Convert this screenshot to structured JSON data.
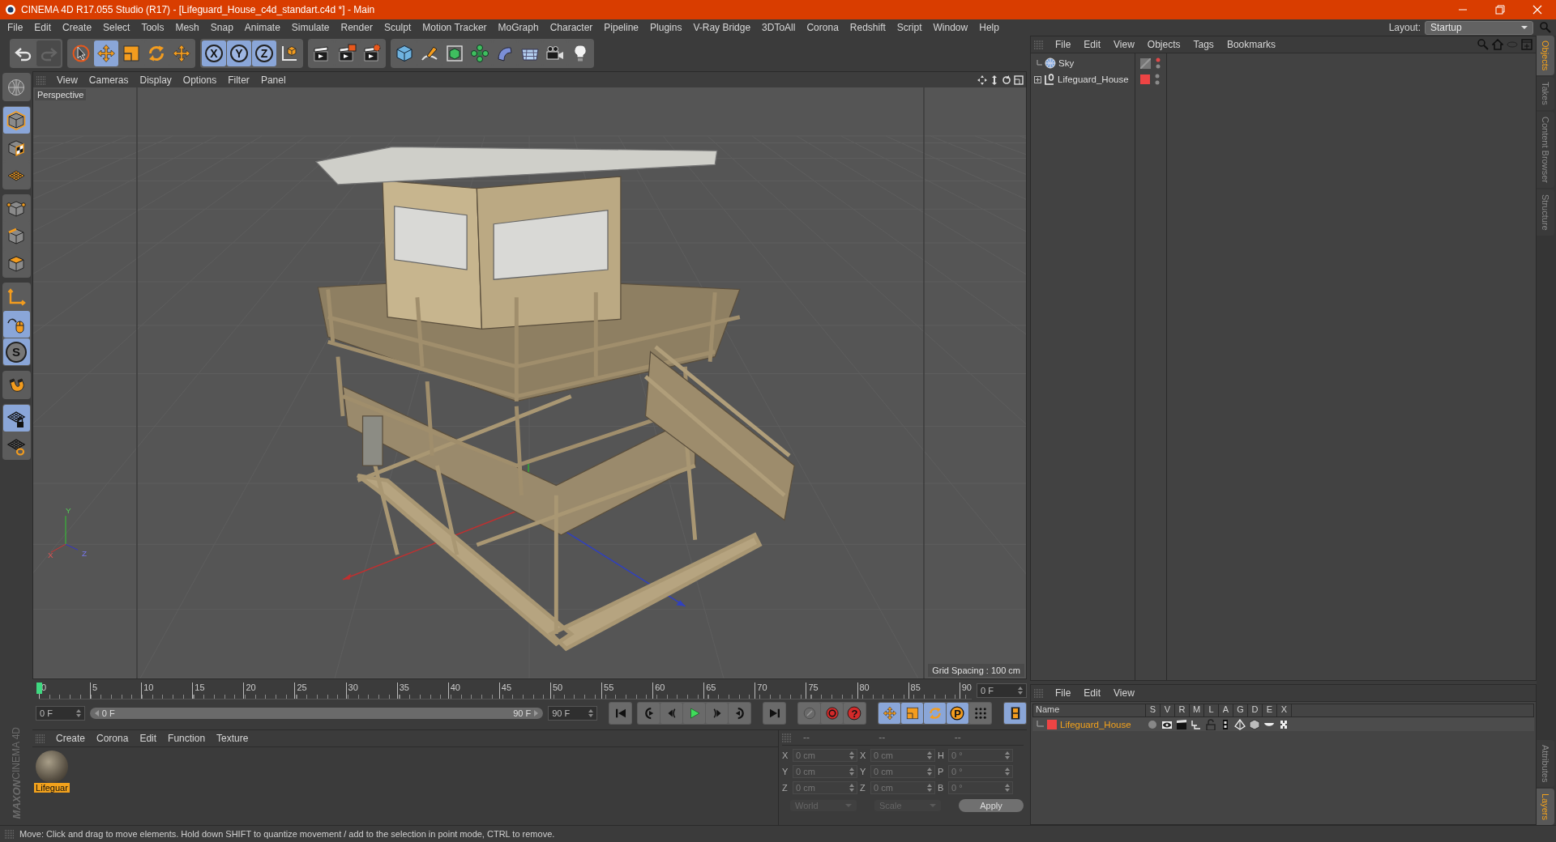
{
  "window": {
    "title": "CINEMA 4D R17.055 Studio (R17) - [Lifeguard_House_c4d_standart.c4d *] - Main"
  },
  "menu_bar": [
    "File",
    "Edit",
    "Create",
    "Select",
    "Tools",
    "Mesh",
    "Snap",
    "Animate",
    "Simulate",
    "Render",
    "Sculpt",
    "Motion Tracker",
    "MoGraph",
    "Character",
    "Pipeline",
    "Plugins",
    "V-Ray Bridge",
    "3DToAll",
    "Corona",
    "Redshift",
    "Script",
    "Window",
    "Help"
  ],
  "layout": {
    "label": "Layout:",
    "value": "Startup"
  },
  "toolbar": [
    [
      {
        "kind": "undo",
        "selected": false,
        "disabled": false
      },
      {
        "kind": "redo",
        "selected": false,
        "disabled": true
      }
    ],
    [
      {
        "kind": "live-select",
        "selected": false,
        "disabled": false
      },
      {
        "kind": "move",
        "selected": true,
        "disabled": false
      },
      {
        "kind": "scale",
        "selected": false,
        "disabled": false
      },
      {
        "kind": "rotate",
        "selected": false,
        "disabled": false
      },
      {
        "kind": "move",
        "selected": false,
        "disabled": false
      }
    ],
    [
      {
        "kind": "axis-lock",
        "label": "X",
        "selected": true,
        "disabled": false
      },
      {
        "kind": "axis-lock",
        "label": "Y",
        "selected": true,
        "disabled": false
      },
      {
        "kind": "axis-lock",
        "label": "Z",
        "selected": true,
        "disabled": false
      },
      {
        "kind": "coord-system",
        "selected": false,
        "disabled": false
      }
    ],
    [
      {
        "kind": "render-view",
        "selected": false,
        "disabled": false
      },
      {
        "kind": "render-picture",
        "selected": false,
        "disabled": false
      },
      {
        "kind": "render-settings",
        "selected": false,
        "disabled": false
      }
    ],
    [
      {
        "kind": "cube",
        "selected": false,
        "disabled": false
      },
      {
        "kind": "pen",
        "selected": false,
        "disabled": false
      },
      {
        "kind": "subdivision",
        "selected": false,
        "disabled": false
      },
      {
        "kind": "cloner",
        "selected": false,
        "disabled": false
      },
      {
        "kind": "deformer",
        "selected": false,
        "disabled": false
      },
      {
        "kind": "floor",
        "selected": false,
        "disabled": false
      },
      {
        "kind": "camera",
        "selected": false,
        "disabled": false
      },
      {
        "kind": "light",
        "selected": false,
        "disabled": false
      }
    ]
  ],
  "left_tools": [
    [
      {
        "kind": "globe",
        "selected": false
      }
    ],
    [
      {
        "kind": "model",
        "selected": true
      },
      {
        "kind": "texture",
        "selected": false
      },
      {
        "kind": "workplane",
        "selected": false
      }
    ],
    [
      {
        "kind": "points",
        "selected": false
      },
      {
        "kind": "edges",
        "selected": false
      },
      {
        "kind": "polygons",
        "selected": false
      }
    ],
    [
      {
        "kind": "axis",
        "selected": false
      },
      {
        "kind": "tweak",
        "selected": true
      },
      {
        "kind": "snap",
        "label": "S",
        "selected": true
      }
    ],
    [
      {
        "kind": "magnet",
        "selected": false
      }
    ],
    [
      {
        "kind": "workplane-lock",
        "selected": true
      },
      {
        "kind": "workplane-rotate",
        "selected": false
      }
    ]
  ],
  "logo": {
    "brand": "MAXON",
    "product": "CINEMA 4D"
  },
  "viewport": {
    "menu": [
      "View",
      "Cameras",
      "Display",
      "Options",
      "Filter",
      "Panel"
    ],
    "camera_label": "Perspective",
    "grid_label": "Grid Spacing : 100 cm",
    "gizmo_labels": [
      "Y",
      "X",
      "Z"
    ]
  },
  "timeline": {
    "ticks": [
      "0",
      "5",
      "10",
      "15",
      "20",
      "25",
      "30",
      "35",
      "40",
      "45",
      "50",
      "55",
      "60",
      "65",
      "70",
      "75",
      "80",
      "85",
      "90"
    ],
    "current_frame": "0 F",
    "start_field": "0 F",
    "range": {
      "start": "0 F",
      "end": "90 F",
      "level": 1
    },
    "end_field": "90 F"
  },
  "transport": [
    {
      "kind": "first"
    },
    {
      "kind": "prev-key"
    },
    {
      "kind": "prev-frame"
    },
    {
      "kind": "play"
    },
    {
      "kind": "next-frame"
    },
    {
      "kind": "next-key"
    },
    {
      "kind": "last"
    }
  ],
  "record": [
    {
      "kind": "record-off"
    },
    {
      "kind": "record"
    },
    {
      "kind": "autokey",
      "label": "?"
    }
  ],
  "keys": [
    {
      "kind": "move",
      "selected": true
    },
    {
      "kind": "scale",
      "selected": true
    },
    {
      "kind": "rotate",
      "selected": true
    },
    {
      "kind": "param",
      "label": "P",
      "selected": true
    },
    {
      "kind": "dots",
      "selected": false
    },
    {
      "kind": "film",
      "selected": true
    }
  ],
  "materials": {
    "menu": [
      "Create",
      "Corona",
      "Edit",
      "Function",
      "Texture"
    ],
    "items": [
      {
        "name": "Lifeguar",
        "selected": true
      }
    ]
  },
  "coordinates": {
    "headers": [
      "--",
      "--",
      "--"
    ],
    "rows": [
      {
        "axis": "X",
        "position": "0 cm",
        "size_axis": "X",
        "size": "0 cm",
        "rot_axis": "H",
        "rotation": "0 °"
      },
      {
        "axis": "Y",
        "position": "0 cm",
        "size_axis": "Y",
        "size": "0 cm",
        "rot_axis": "P",
        "rotation": "0 °"
      },
      {
        "axis": "Z",
        "position": "0 cm",
        "size_axis": "Z",
        "size": "0 cm",
        "rot_axis": "B",
        "rotation": "0 °"
      }
    ],
    "mode": "World",
    "transform": "Scale",
    "apply": "Apply"
  },
  "objects": {
    "menu": [
      "File",
      "Edit",
      "View",
      "Objects",
      "Tags",
      "Bookmarks"
    ],
    "items": [
      {
        "name": "Sky",
        "kind": "sky",
        "expandable": false,
        "editor_off": true
      },
      {
        "name": "Lifeguard_House",
        "kind": "null",
        "expandable": true,
        "color": "#ee4444",
        "editor_off": false
      }
    ]
  },
  "layers": {
    "menu": [
      "File",
      "Edit",
      "View"
    ],
    "columns": [
      "Name",
      "S",
      "V",
      "R",
      "M",
      "L",
      "A",
      "G",
      "D",
      "E",
      "X"
    ],
    "rows": [
      {
        "name": "Lifeguard_House",
        "color": "#ee4444"
      }
    ]
  },
  "side_tabs": {
    "top": [
      {
        "label": "Objects",
        "selected": true
      },
      {
        "label": "Takes",
        "selected": false
      },
      {
        "label": "Content Browser",
        "selected": false
      },
      {
        "label": "Structure",
        "selected": false
      }
    ],
    "bottom": [
      {
        "label": "Attributes",
        "selected": false
      },
      {
        "label": "Layers",
        "selected": true
      }
    ]
  },
  "status_bar": "Move: Click and drag to move elements. Hold down SHIFT to quantize movement / add to the selection in point mode, CTRL to remove."
}
